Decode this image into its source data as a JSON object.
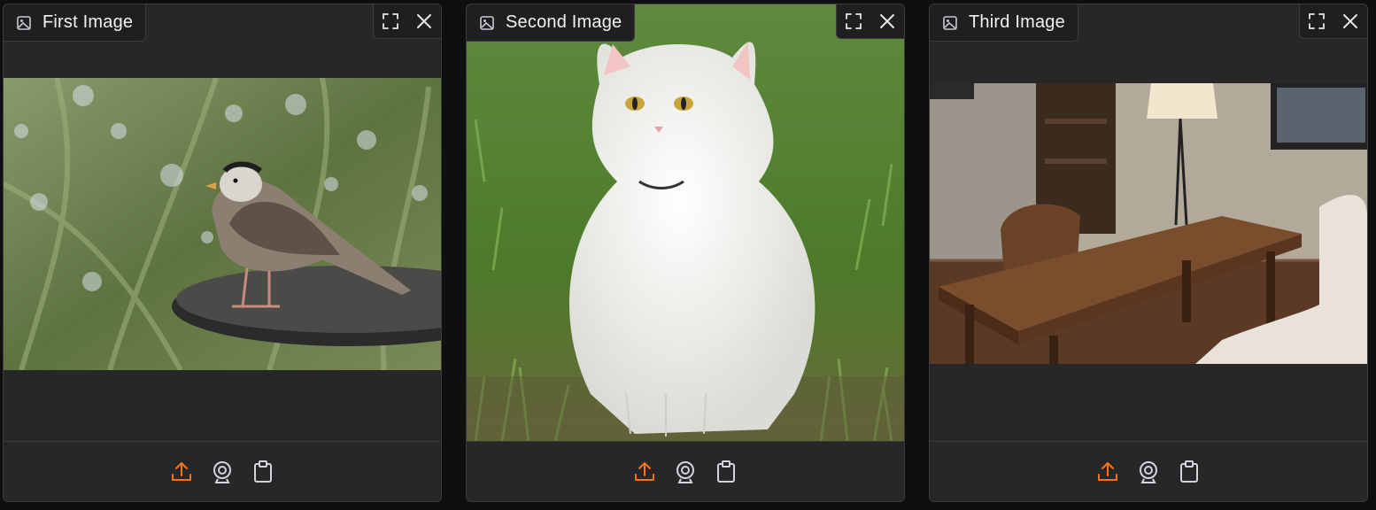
{
  "panels": [
    {
      "title": "First Image",
      "image": "sparrow-on-table-photo"
    },
    {
      "title": "Second Image",
      "image": "white-cat-on-grass-photo"
    },
    {
      "title": "Third Image",
      "image": "wooden-table-room-photo"
    }
  ],
  "icons": {
    "tab": "image-icon",
    "fullscreen": "fullscreen-icon",
    "close": "close-icon",
    "upload": "upload-icon",
    "webcam": "webcam-icon",
    "clipboard": "clipboard-icon"
  },
  "colors": {
    "accent": "#f97316",
    "panel_bg": "#27272a",
    "page_bg": "#0f0f12"
  }
}
